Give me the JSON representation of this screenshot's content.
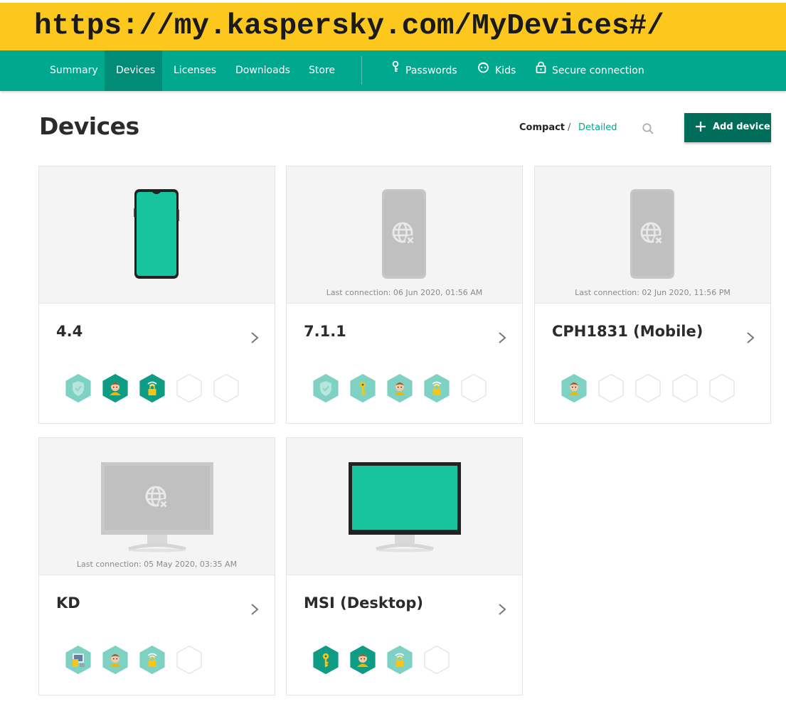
{
  "browser": {
    "url": "https://my.kaspersky.com/MyDevices#/"
  },
  "nav": {
    "items": [
      {
        "label": "Summary"
      },
      {
        "label": "Devices"
      },
      {
        "label": "Licenses"
      },
      {
        "label": "Downloads"
      },
      {
        "label": "Store"
      },
      {
        "label": "Passwords",
        "icon": "key-icon"
      },
      {
        "label": "Kids",
        "icon": "kids-icon"
      },
      {
        "label": "Secure connection",
        "icon": "lock-icon"
      }
    ],
    "active": "Devices"
  },
  "page": {
    "title": "Devices",
    "view_compact": "Compact",
    "view_separator": "/",
    "view_detailed": "Detailed",
    "add_device": "Add device"
  },
  "colors": {
    "url_bar": "#fcc81e",
    "nav": "#00a88e",
    "nav_active": "#008c77",
    "add_button": "#006d5b",
    "badge_dark": "#0f9c84",
    "badge_light": "#7fd1c3"
  },
  "devices": [
    {
      "name": "4.4",
      "type": "phone",
      "online": true,
      "last_connection": "",
      "badges": [
        {
          "icon": "shield-check-icon",
          "style": "light"
        },
        {
          "icon": "kid-icon",
          "style": "dark"
        },
        {
          "icon": "wifi-lock-icon",
          "style": "dark"
        },
        {
          "icon": "empty",
          "style": "empty"
        },
        {
          "icon": "empty",
          "style": "empty"
        }
      ]
    },
    {
      "name": "7.1.1",
      "type": "phone",
      "online": false,
      "last_connection": "Last connection:  06 Jun 2020, 01:56 AM",
      "badges": [
        {
          "icon": "shield-check-icon",
          "style": "light"
        },
        {
          "icon": "key-icon",
          "style": "light"
        },
        {
          "icon": "kid-icon",
          "style": "light"
        },
        {
          "icon": "wifi-lock-icon",
          "style": "light"
        },
        {
          "icon": "empty",
          "style": "empty"
        }
      ]
    },
    {
      "name": "CPH1831 (Mobile)",
      "type": "phone",
      "online": false,
      "last_connection": "Last connection:  02 Jun 2020, 11:56 PM",
      "badges": [
        {
          "icon": "kid-icon",
          "style": "light"
        },
        {
          "icon": "empty",
          "style": "empty"
        },
        {
          "icon": "empty",
          "style": "empty"
        },
        {
          "icon": "empty",
          "style": "empty"
        },
        {
          "icon": "empty",
          "style": "empty"
        }
      ]
    },
    {
      "name": "KD",
      "type": "monitor",
      "online": false,
      "last_connection": "Last connection:  05 May 2020, 03:35 AM",
      "badges": [
        {
          "icon": "pc-app-icon",
          "style": "light"
        },
        {
          "icon": "kid-icon",
          "style": "light"
        },
        {
          "icon": "wifi-lock-icon",
          "style": "light"
        },
        {
          "icon": "empty",
          "style": "empty"
        }
      ]
    },
    {
      "name": "MSI (Desktop)",
      "type": "monitor",
      "online": true,
      "last_connection": "",
      "badges": [
        {
          "icon": "key-icon",
          "style": "dark"
        },
        {
          "icon": "kid-icon",
          "style": "dark"
        },
        {
          "icon": "wifi-lock-icon",
          "style": "light"
        },
        {
          "icon": "empty",
          "style": "empty"
        }
      ]
    }
  ]
}
